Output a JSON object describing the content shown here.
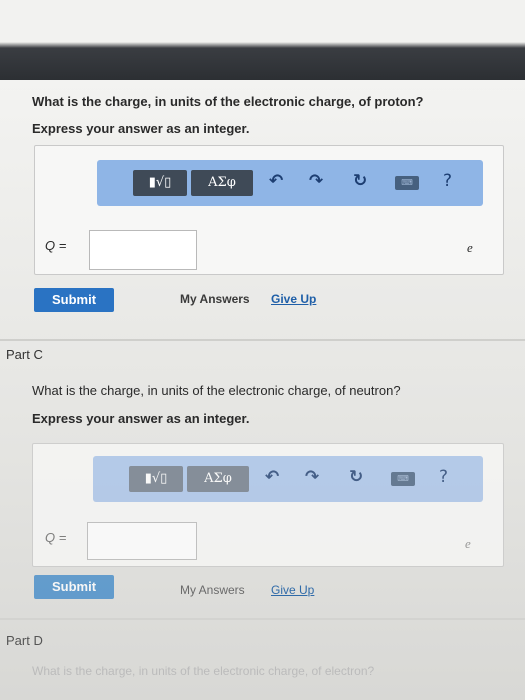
{
  "part_b": {
    "question": "What is the charge, in units of the electronic charge, of proton?",
    "instruction": "Express your answer as an integer.",
    "variable": "Q =",
    "unit": "e",
    "submit": "Submit",
    "my_answers": "My Answers",
    "give_up": "Give Up"
  },
  "part_c": {
    "title": "Part C",
    "question": "What is the charge, in units of the electronic charge, of neutron?",
    "instruction": "Express your answer as an integer.",
    "variable": "Q =",
    "unit": "e",
    "submit": "Submit",
    "my_answers": "My Answers",
    "give_up": "Give Up"
  },
  "part_d": {
    "title": "Part D",
    "question": "What is the charge, in units of the electronic charge, of electron?"
  },
  "toolbar": {
    "template_label": "▮√▯",
    "greek_label": "ΑΣφ",
    "undo": "↶",
    "redo": "↷",
    "reset": "↻",
    "keyboard": "⌨",
    "help": "?"
  },
  "colors": {
    "toolbar_bg": "#8fb5e6",
    "button_dark": "#3f4a57",
    "submit_blue": "#2a73c3",
    "link_blue": "#1f5fa8"
  },
  "icons": [
    "undo-icon",
    "redo-icon",
    "reset-icon",
    "keyboard-icon",
    "help-icon"
  ]
}
